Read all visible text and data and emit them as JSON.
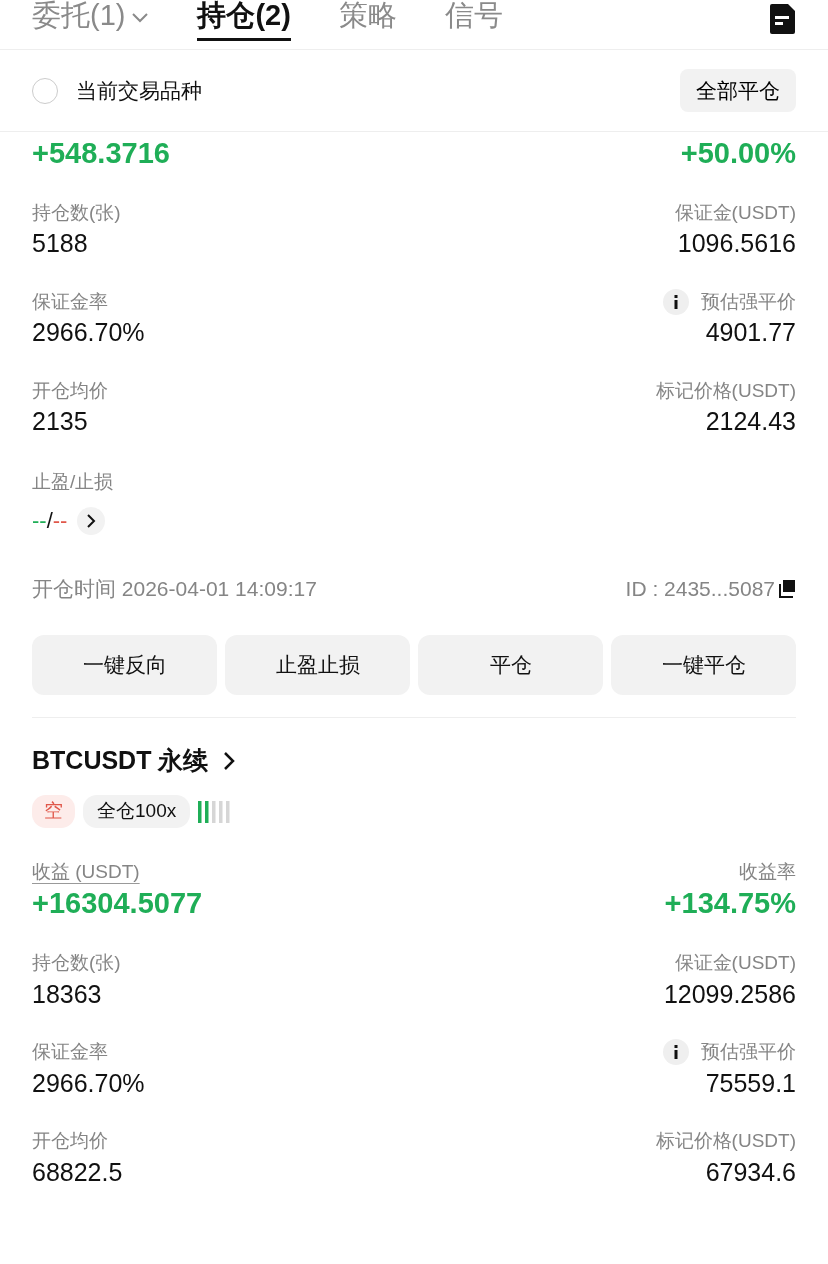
{
  "tabs": [
    {
      "label": "委托(1)",
      "selected": false,
      "has_menu": true
    },
    {
      "label": "持仓(2)",
      "selected": true,
      "has_menu": false
    },
    {
      "label": "策略",
      "selected": false,
      "has_menu": false
    },
    {
      "label": "信号",
      "selected": false,
      "has_menu": false
    }
  ],
  "filter": {
    "label": "当前交易品种",
    "checked": false,
    "button": "全部平仓"
  },
  "positions": [
    {
      "pnl": "+548.3716",
      "roe": "+50.00%",
      "rows": [
        {
          "left": {
            "label": "持仓数(张)",
            "value": "5188"
          },
          "right": {
            "label": "保证金(USDT)",
            "value": "1096.5616",
            "info": false
          }
        },
        {
          "left": {
            "label": "保证金率",
            "value": "2966.70%"
          },
          "right": {
            "label": "预估强平价",
            "value": "4901.77",
            "info": true
          }
        },
        {
          "left": {
            "label": "开仓均价",
            "value": "2135"
          },
          "right": {
            "label": "标记价格(USDT)",
            "value": "2124.43",
            "info": false
          }
        }
      ],
      "tpsl": {
        "label": "止盈/止损",
        "tp": "--",
        "sep": "/",
        "sl": "--"
      },
      "open_time": "开仓时间 2026-04-01 14:09:17",
      "id": "ID : 2435...5087",
      "actions": [
        "一键反向",
        "止盈止损",
        "平仓",
        "一键平仓"
      ]
    },
    {
      "title": "BTCUSDT 永续",
      "side": "空",
      "margin_mode": "全仓100x",
      "risk": {
        "level": 0.4
      },
      "pnl_label": "收益 (USDT)",
      "roe_label": "收益率",
      "pnl": "+16304.5077",
      "roe": "+134.75%",
      "rows": [
        {
          "left": {
            "label": "持仓数(张)",
            "value": "18363"
          },
          "right": {
            "label": "保证金(USDT)",
            "value": "12099.2586",
            "info": false
          }
        },
        {
          "left": {
            "label": "保证金率",
            "value": "2966.70%"
          },
          "right": {
            "label": "预估强平价",
            "value": "75559.1",
            "info": true
          }
        },
        {
          "left": {
            "label": "开仓均价",
            "value": "68822.5"
          },
          "right": {
            "label": "标记价格(USDT)",
            "value": "67934.6",
            "info": false
          }
        }
      ]
    }
  ]
}
